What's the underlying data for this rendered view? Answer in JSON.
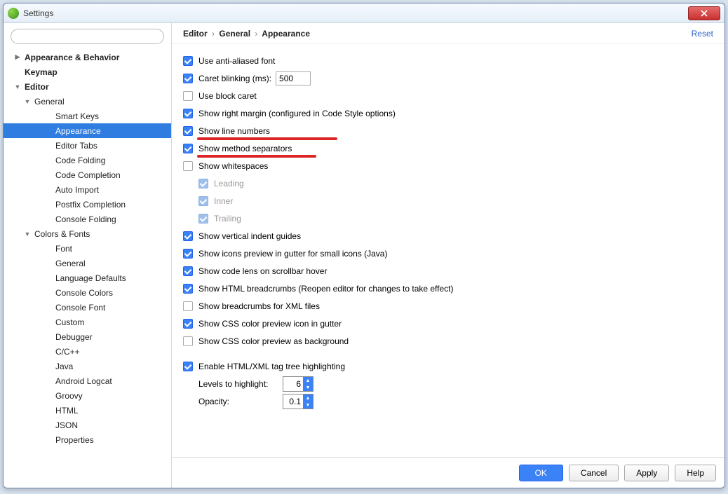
{
  "window": {
    "title": "Settings"
  },
  "search": {
    "placeholder": ""
  },
  "tree": {
    "items": [
      {
        "label": "Appearance & Behavior",
        "level": 1,
        "arrow": "right",
        "bold": true
      },
      {
        "label": "Keymap",
        "level": 1,
        "arrow": "none",
        "bold": true
      },
      {
        "label": "Editor",
        "level": 1,
        "arrow": "down",
        "bold": true
      },
      {
        "label": "General",
        "level": 2,
        "arrow": "down"
      },
      {
        "label": "Smart Keys",
        "level": 3,
        "arrow": "none"
      },
      {
        "label": "Appearance",
        "level": 3,
        "arrow": "none",
        "selected": true
      },
      {
        "label": "Editor Tabs",
        "level": 3,
        "arrow": "none"
      },
      {
        "label": "Code Folding",
        "level": 3,
        "arrow": "none"
      },
      {
        "label": "Code Completion",
        "level": 3,
        "arrow": "none"
      },
      {
        "label": "Auto Import",
        "level": 3,
        "arrow": "none"
      },
      {
        "label": "Postfix Completion",
        "level": 3,
        "arrow": "none"
      },
      {
        "label": "Console Folding",
        "level": 3,
        "arrow": "none"
      },
      {
        "label": "Colors & Fonts",
        "level": 2,
        "arrow": "down"
      },
      {
        "label": "Font",
        "level": 3,
        "arrow": "none"
      },
      {
        "label": "General",
        "level": 3,
        "arrow": "none"
      },
      {
        "label": "Language Defaults",
        "level": 3,
        "arrow": "none"
      },
      {
        "label": "Console Colors",
        "level": 3,
        "arrow": "none"
      },
      {
        "label": "Console Font",
        "level": 3,
        "arrow": "none"
      },
      {
        "label": "Custom",
        "level": 3,
        "arrow": "none"
      },
      {
        "label": "Debugger",
        "level": 3,
        "arrow": "none"
      },
      {
        "label": "C/C++",
        "level": 3,
        "arrow": "none"
      },
      {
        "label": "Java",
        "level": 3,
        "arrow": "none"
      },
      {
        "label": "Android Logcat",
        "level": 3,
        "arrow": "none"
      },
      {
        "label": "Groovy",
        "level": 3,
        "arrow": "none"
      },
      {
        "label": "HTML",
        "level": 3,
        "arrow": "none"
      },
      {
        "label": "JSON",
        "level": 3,
        "arrow": "none"
      },
      {
        "label": "Properties",
        "level": 3,
        "arrow": "none"
      }
    ]
  },
  "breadcrumb": {
    "p0": "Editor",
    "p1": "General",
    "p2": "Appearance",
    "reset": "Reset"
  },
  "opts": {
    "antialiased": {
      "label": "Use anti-aliased font",
      "checked": true
    },
    "caret_blink": {
      "label": "Caret blinking (ms):",
      "checked": true,
      "value": "500"
    },
    "block_caret": {
      "label": "Use block caret",
      "checked": false
    },
    "right_margin": {
      "label": "Show right margin (configured in Code Style options)",
      "checked": true
    },
    "line_numbers": {
      "label": "Show line numbers",
      "checked": true
    },
    "method_sep": {
      "label": "Show method separators",
      "checked": true
    },
    "whitespaces": {
      "label": "Show whitespaces",
      "checked": false
    },
    "ws_leading": {
      "label": "Leading",
      "checked": true
    },
    "ws_inner": {
      "label": "Inner",
      "checked": true
    },
    "ws_trailing": {
      "label": "Trailing",
      "checked": true
    },
    "indent_guides": {
      "label": "Show vertical indent guides",
      "checked": true
    },
    "icons_preview": {
      "label": "Show icons preview in gutter for small icons (Java)",
      "checked": true
    },
    "code_lens": {
      "label": "Show code lens on scrollbar hover",
      "checked": true
    },
    "html_crumbs": {
      "label": "Show HTML breadcrumbs (Reopen editor for changes to take effect)",
      "checked": true
    },
    "xml_crumbs": {
      "label": "Show breadcrumbs for XML files",
      "checked": false
    },
    "css_preview": {
      "label": "Show CSS color preview icon in gutter",
      "checked": true
    },
    "css_bg": {
      "label": "Show CSS color preview as background",
      "checked": false
    },
    "tag_tree": {
      "label": "Enable HTML/XML tag tree highlighting",
      "checked": true
    },
    "levels": {
      "label": "Levels to highlight:",
      "value": "6"
    },
    "opacity": {
      "label": "Opacity:",
      "value": "0.1"
    }
  },
  "buttons": {
    "ok": "OK",
    "cancel": "Cancel",
    "apply": "Apply",
    "help": "Help"
  }
}
